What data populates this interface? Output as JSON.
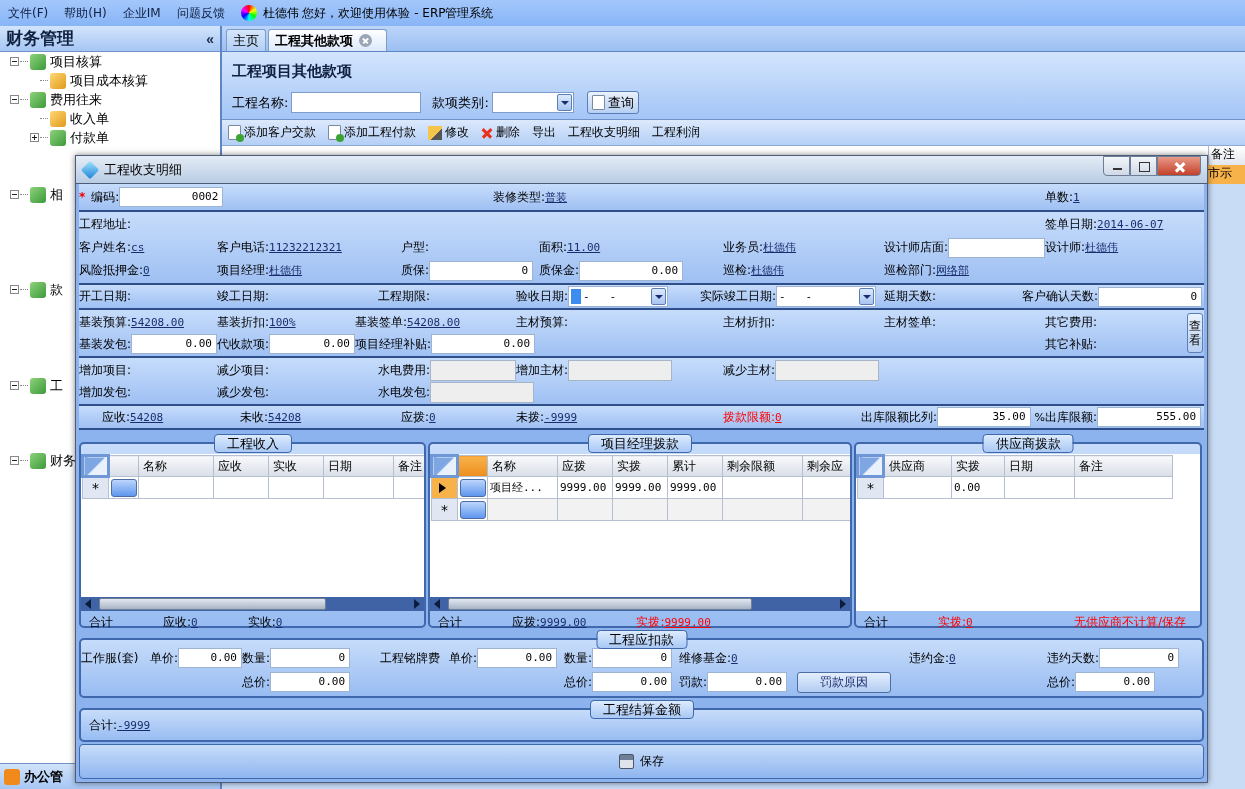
{
  "menu_bar": {
    "items": [
      "文件(F)",
      "帮助(H)",
      "企业IM",
      "问题反馈"
    ],
    "greeting": "杜德伟 您好，欢迎使用体验 - ERP管理系统"
  },
  "sidebar": {
    "title": "财务管理",
    "collapse": "«",
    "items": [
      {
        "label": "项目核算",
        "expanded": true,
        "children": [
          {
            "label": "项目成本核算"
          }
        ]
      },
      {
        "label": "费用往来",
        "expanded": true,
        "children": [
          {
            "label": "收入单"
          },
          {
            "label": "付款单",
            "expanded": false
          }
        ]
      },
      {
        "label": "相",
        "expanded": true
      },
      {
        "label": "款",
        "expanded": true
      },
      {
        "label": "工",
        "expanded": true
      },
      {
        "label": "财务",
        "expanded": true
      }
    ],
    "bottom": "办公管"
  },
  "main": {
    "tabs": [
      {
        "label": "主页",
        "selected": false
      },
      {
        "label": "工程其他款项",
        "selected": true
      }
    ],
    "title": "工程项目其他款项",
    "search": {
      "name_label": "工程名称:",
      "type_label": "款项类别:",
      "button": "查询"
    },
    "toolbar": [
      {
        "kind": "add",
        "label": "添加客户交款"
      },
      {
        "kind": "add",
        "label": "添加工程付款"
      },
      {
        "kind": "edit",
        "label": "修改"
      },
      {
        "kind": "delete",
        "label": "删除"
      },
      {
        "kind": "plain",
        "label": "导出"
      },
      {
        "kind": "plain",
        "label": "工程收支明细"
      },
      {
        "kind": "plain",
        "label": "工程利润"
      }
    ],
    "table": {
      "columns": [
        "备注"
      ],
      "rows": [
        {
          "selected": true,
          "cells": [
            "市示"
          ]
        }
      ]
    }
  },
  "dialog": {
    "title": "工程收支明细",
    "sections": [
      {
        "rows": [
          [
            {
              "kind": "input",
              "label": "编码:",
              "value": "0002",
              "required_mark": "*"
            },
            {
              "kind": "link",
              "label": "装修类型:",
              "value": "普装"
            },
            {
              "kind": "link",
              "label": "单数:",
              "value": "1"
            }
          ]
        ]
      },
      {
        "rows": [
          [
            {
              "kind": "plain",
              "label": "工程地址:"
            },
            "",
            "",
            "",
            "",
            "",
            {
              "kind": "link",
              "label": "签单日期:",
              "value": "2014-06-07"
            }
          ],
          [
            {
              "kind": "link",
              "label": "客户姓名:",
              "value": "cs"
            },
            {
              "kind": "link",
              "label": "客户电话:",
              "value": "11232212321"
            },
            {
              "kind": "plain",
              "label": "户型:"
            },
            {
              "kind": "link",
              "label": "面积:",
              "value": "11.00"
            },
            {
              "kind": "link",
              "label": "业务员:",
              "value": "杜德伟"
            },
            {
              "kind": "input",
              "label": "设计师店面:"
            },
            {
              "kind": "link",
              "label": "设计师:",
              "value": "杜德伟"
            }
          ],
          [
            {
              "kind": "link",
              "label": "风险抵押金:",
              "value": "0"
            },
            {
              "kind": "link",
              "label": "项目经理:",
              "value": "杜德伟"
            },
            {
              "kind": "input",
              "label": "质保:",
              "value": "0"
            },
            {
              "kind": "input",
              "label": "质保金:",
              "value": "0.00"
            },
            {
              "kind": "link",
              "label": "巡检:",
              "value": "杜德伟"
            },
            {
              "kind": "link",
              "label": "巡检部门:",
              "value": "网络部"
            }
          ]
        ]
      },
      {
        "rows": [
          [
            {
              "kind": "plain",
              "label": "开工日期:"
            },
            {
              "kind": "plain",
              "label": "竣工日期:"
            },
            {
              "kind": "plain",
              "label": "工程期限:"
            },
            {
              "kind": "combo",
              "label": "验收日期:",
              "value": "-   -",
              "focused": true
            },
            {
              "kind": "combo",
              "label": "实际竣工日期:",
              "value": "-   -",
              "focused": false
            },
            {
              "kind": "plain",
              "label": "延期天数:"
            },
            {
              "kind": "input",
              "label": "客户确认天数:",
              "value": "0"
            }
          ]
        ]
      },
      {
        "side_button": "查看",
        "rows": [
          [
            {
              "kind": "link",
              "label": "基装预算:",
              "value": "54208.00"
            },
            {
              "kind": "link",
              "label": "基装折扣:",
              "value": "100%"
            },
            {
              "kind": "link",
              "label": "基装签单:",
              "value": "54208.00"
            },
            {
              "kind": "plain",
              "label": "主材预算:"
            },
            {
              "kind": "plain",
              "label": "主材折扣:"
            },
            {
              "kind": "plain",
              "label": "主材签单:"
            },
            {
              "kind": "plain",
              "label": "其它费用:"
            }
          ],
          [
            {
              "kind": "input",
              "label": "基装发包:",
              "value": "0.00"
            },
            {
              "kind": "input",
              "label": "代收款项:",
              "value": "0.00"
            },
            {
              "kind": "input",
              "label": "项目经理补贴:",
              "value": "0.00"
            },
            "",
            "",
            "",
            {
              "kind": "plain",
              "label": "其它补贴:"
            }
          ]
        ]
      },
      {
        "rows": [
          [
            {
              "kind": "plain",
              "label": "增加项目:"
            },
            {
              "kind": "plain",
              "label": "减少项目:"
            },
            {
              "kind": "disabled",
              "label": "水电费用:"
            },
            {
              "kind": "disabled",
              "label": "增加主材:"
            },
            {
              "kind": "disabled",
              "label": "减少主材:"
            }
          ],
          [
            {
              "kind": "plain",
              "label": "增加发包:"
            },
            {
              "kind": "plain",
              "label": "减少发包:"
            },
            {
              "kind": "disabled",
              "label": "水电发包:"
            }
          ]
        ]
      },
      {
        "rows": [
          [
            {
              "kind": "link",
              "label": "应收:",
              "value": "54208",
              "alert": false
            },
            {
              "kind": "link",
              "label": "未收:",
              "value": "54208",
              "alert": false
            },
            {
              "kind": "link",
              "label": "应拨:",
              "value": "0",
              "alert": false
            },
            {
              "kind": "link",
              "label": "未拨:",
              "value": "-9999",
              "alert": false
            },
            {
              "kind": "link",
              "label": "拨款限额:",
              "value": "0",
              "alert": true
            },
            {
              "kind": "input",
              "label": "出库限额比列:",
              "value": "35.00",
              "suffix": "%",
              "alert": false
            },
            {
              "kind": "input",
              "label": "出库限额:",
              "value": "555.00",
              "alert": false
            }
          ]
        ]
      }
    ],
    "panels": [
      {
        "title": "工程收入",
        "row_buttons": true,
        "horizontal_scroll": true,
        "columns": [
          "名称",
          "应收",
          "实收",
          "日期",
          "备注"
        ],
        "rows": [
          {
            "selected": false,
            "marker": "*"
          }
        ],
        "footer": {
          "label": "合计",
          "totals": [
            {
              "label": "应收:",
              "value": "0",
              "alert": false
            },
            {
              "label": "实收:",
              "value": "0",
              "alert": false
            }
          ]
        }
      },
      {
        "title": "项目经理拨款",
        "row_buttons": true,
        "horizontal_scroll": true,
        "columns": [
          "名称",
          "应拨",
          "实拨",
          "累计",
          "剩余限额",
          "剩余应"
        ],
        "rows": [
          {
            "selected": true,
            "cells": [
              "项目经...",
              "9999.00",
              "9999.00",
              "9999.00"
            ]
          },
          {
            "selected": false,
            "marker": "*"
          }
        ],
        "footer": {
          "label": "合计",
          "totals": [
            {
              "label": "应拨:",
              "value": "9999.00",
              "alert": false
            },
            {
              "label": "实拨:",
              "value": "9999.00",
              "alert": true
            }
          ]
        }
      },
      {
        "title": "供应商拨款",
        "row_buttons": false,
        "horizontal_scroll": false,
        "columns": [
          "供应商",
          "实拨",
          "日期",
          "备注"
        ],
        "rows": [
          {
            "selected": false,
            "marker": "*",
            "cells": [
              null,
              "0.00"
            ]
          }
        ],
        "footer": {
          "label": "合计",
          "totals": [
            {
              "label": "实拨:",
              "value": "0",
              "alert": true
            }
          ],
          "note": "无供应商不计算/保存"
        }
      }
    ],
    "deductions": {
      "title": "工程应扣款",
      "rows": [
        [
          {
            "kind": "plain",
            "label": "工作服(套)"
          },
          {
            "kind": "input",
            "label": "单价:",
            "value": "0.00"
          },
          {
            "kind": "input",
            "label": "数量:",
            "value": "0"
          },
          {
            "kind": "plain",
            "label": "工程铭牌费"
          },
          {
            "kind": "input",
            "label": "单价:",
            "value": "0.00"
          },
          {
            "kind": "input",
            "label": "数量:",
            "value": "0"
          },
          {
            "kind": "link",
            "label": "维修基金:",
            "value": "0"
          },
          {
            "kind": "link",
            "label": "违约金:",
            "value": "0"
          },
          {
            "kind": "input",
            "label": "违约天数:",
            "value": "0"
          }
        ],
        [
          "",
          "",
          {
            "kind": "input",
            "label": "总价:",
            "value": "0.00"
          },
          "",
          "",
          {
            "kind": "input",
            "label": "总价:",
            "value": "0.00"
          },
          {
            "kind": "input",
            "label": "罚款:",
            "value": "0.00",
            "button": "罚款原因"
          },
          "",
          {
            "kind": "input",
            "label": "总价:",
            "value": "0.00"
          }
        ]
      ]
    },
    "settlement": {
      "title": "工程结算金额",
      "items": [
        {
          "kind": "link",
          "label": "合计:",
          "value": "-9999"
        }
      ]
    },
    "save_button": "保存"
  }
}
